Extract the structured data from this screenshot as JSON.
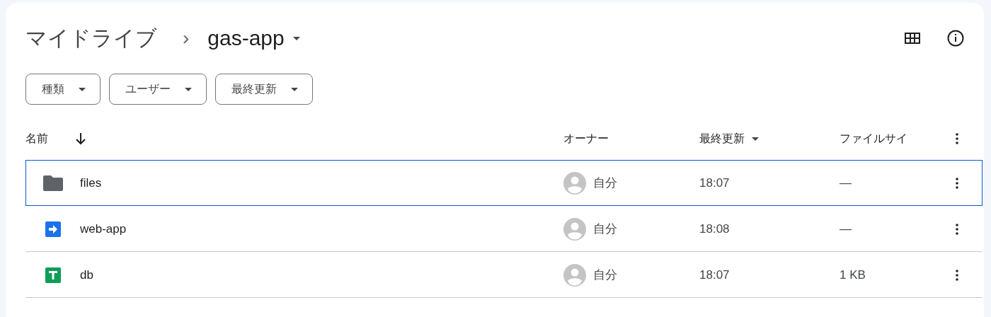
{
  "breadcrumb": {
    "root": "マイドライブ",
    "separator": "›",
    "current": "gas-app"
  },
  "filters": [
    {
      "label": "種類"
    },
    {
      "label": "ユーザー"
    },
    {
      "label": "最終更新"
    }
  ],
  "table": {
    "columns": [
      {
        "label": "名前",
        "sorted": true,
        "menu": false
      },
      {
        "label": "オーナー",
        "sorted": false,
        "menu": false
      },
      {
        "label": "最終更新",
        "sorted": false,
        "menu": true
      },
      {
        "label": "ファイルサイ",
        "sorted": false,
        "menu": false
      }
    ],
    "rows": [
      {
        "kind": "folder",
        "name": "files",
        "owner": "自分",
        "modified": "18:07",
        "size": "—",
        "selected": true
      },
      {
        "kind": "script",
        "name": "web-app",
        "owner": "自分",
        "modified": "18:08",
        "size": "—",
        "selected": false
      },
      {
        "kind": "sheet",
        "name": "db",
        "owner": "自分",
        "modified": "18:07",
        "size": "1 KB",
        "selected": false
      }
    ]
  }
}
